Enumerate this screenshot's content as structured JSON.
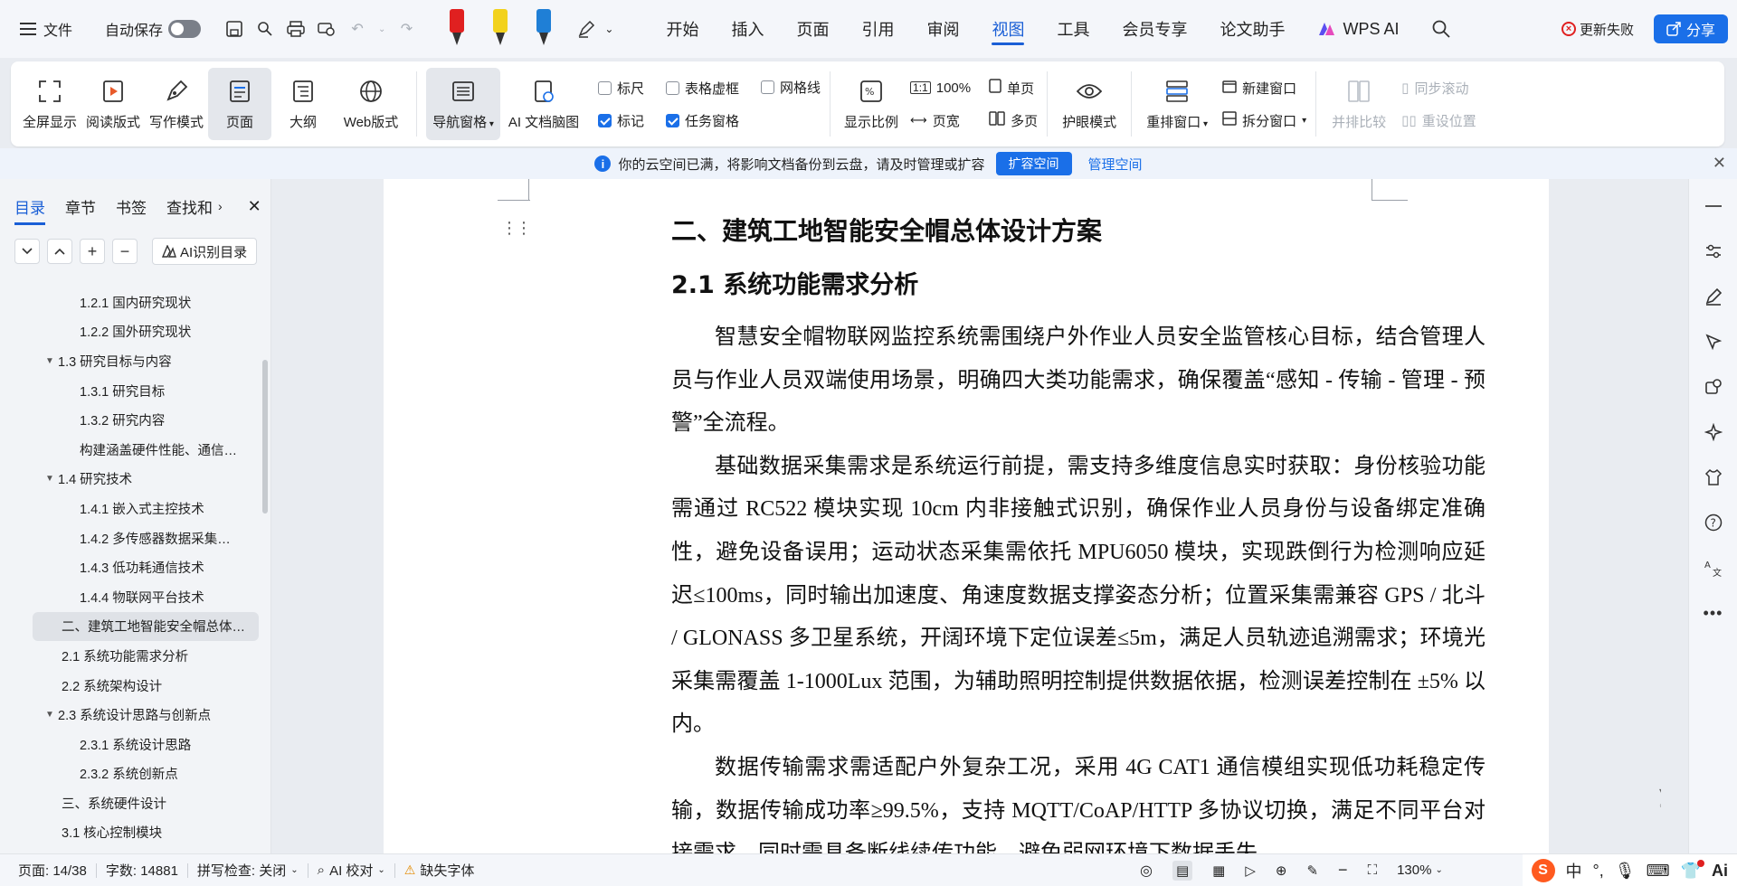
{
  "menubar": {
    "file_label": "文件",
    "autosave_label": "自动保存",
    "tabs": [
      "开始",
      "插入",
      "页面",
      "引用",
      "审阅",
      "视图",
      "工具",
      "会员专享",
      "论文助手",
      "WPS AI"
    ],
    "active_tab": "视图",
    "update_failed_label": "更新失败",
    "share_label": "分享",
    "pen_colors": [
      "#e02020",
      "#f2d21c",
      "#1f7fd6"
    ]
  },
  "ribbon": {
    "fullscreen": "全屏显示",
    "read_mode": "阅读版式",
    "write_mode": "写作模式",
    "page": "页面",
    "outline": "大纲",
    "web_mode": "Web版式",
    "nav_pane": "导航窗格",
    "ai_mindmap": "AI 文档脑图",
    "ruler": "标尺",
    "table_gridlines": "表格虚框",
    "gridlines": "网格线",
    "marks": "标记",
    "task_pane": "任务窗格",
    "display_ratio": "显示比例",
    "zoom_100": "100%",
    "single_page": "单页",
    "page_width": "页宽",
    "multi_page": "多页",
    "eye_mode": "护眼模式",
    "rearrange_windows": "重排窗口",
    "new_window": "新建窗口",
    "split_window": "拆分窗口",
    "side_by_side": "并排比较",
    "sync_scroll": "同步滚动",
    "reset_position": "重设位置"
  },
  "notice": {
    "message": "你的云空间已满，将影响文档备份到云盘，请及时管理或扩容",
    "expand_label": "扩容空间",
    "manage_label": "管理空间"
  },
  "sidebar": {
    "tabs": [
      "目录",
      "章节",
      "书签",
      "查找和"
    ],
    "ai_toc_label": "AI识别目录",
    "toc": [
      {
        "label": "1.2.1  国内研究现状",
        "level": 3,
        "arrow": false
      },
      {
        "label": "1.2.2  国外研究现状",
        "level": 3,
        "arrow": false
      },
      {
        "label": "1.3  研究目标与内容",
        "level": 2,
        "arrow": true
      },
      {
        "label": "1.3.1  研究目标",
        "level": 3,
        "arrow": false
      },
      {
        "label": "1.3.2  研究内容",
        "level": 3,
        "arrow": false
      },
      {
        "label": "构建涵盖硬件性能、通信…",
        "level": 3,
        "arrow": false
      },
      {
        "label": "1.4  研究技术",
        "level": 2,
        "arrow": true
      },
      {
        "label": "1.4.1  嵌入式主控技术",
        "level": 3,
        "arrow": false
      },
      {
        "label": "1.4.2  多传感器数据采集…",
        "level": 3,
        "arrow": false
      },
      {
        "label": "1.4.3  低功耗通信技术",
        "level": 3,
        "arrow": false
      },
      {
        "label": "1.4.4  物联网平台技术",
        "level": 3,
        "arrow": false
      },
      {
        "label": "二、建筑工地智能安全帽总体…",
        "level": 1,
        "arrow": false,
        "selected": true
      },
      {
        "label": "2.1  系统功能需求分析",
        "level": 2,
        "arrow": false
      },
      {
        "label": "2.2  系统架构设计",
        "level": 2,
        "arrow": false
      },
      {
        "label": "2.3  系统设计思路与创新点",
        "level": 2,
        "arrow": true
      },
      {
        "label": "2.3.1  系统设计思路",
        "level": 3,
        "arrow": false
      },
      {
        "label": "2.3.2  系统创新点",
        "level": 3,
        "arrow": false
      },
      {
        "label": "三、系统硬件设计",
        "level": 2,
        "arrow": false
      },
      {
        "label": "3.1  核心控制模块",
        "level": 2,
        "arrow": false
      }
    ]
  },
  "document": {
    "heading1": "二、建筑工地智能安全帽总体设计方案",
    "heading2": "2.1  系统功能需求分析",
    "paragraphs": [
      "智慧安全帽物联网监控系统需围绕户外作业人员安全监管核心目标，结合管理人员与作业人员双端使用场景，明确四大类功能需求，确保覆盖“感知 - 传输 - 管理 - 预警”全流程。",
      "基础数据采集需求是系统运行前提，需支持多维度信息实时获取：身份核验功能需通过 RC522 模块实现 10cm 内非接触式识别，确保作业人员身份与设备绑定准确性，避免设备误用；运动状态采集需依托 MPU6050 模块，实现跌倒行为检测响应延迟≤100ms，同时输出加速度、角速度数据支撑姿态分析；位置采集需兼容 GPS / 北斗 / GLONASS 多卫星系统，开阔环境下定位误差≤5m，满足人员轨迹追溯需求；环境光采集需覆盖 1-1000Lux 范围，为辅助照明控制提供数据依据，检测误差控制在 ±5% 以内。",
      "数据传输需求需适配户外复杂工况，采用 4G CAT1 通信模组实现低功耗稳定传输，数据传输成功率≥99.5%，支持 MQTT/CoAP/HTTP 多协议切换，满足不同平台对接需求，同时需具备断线续传功能，避免弱网环境下数据丢失。"
    ]
  },
  "statusbar": {
    "page": "页面: 14/38",
    "word_count": "字数: 14881",
    "spell_check": "拼写检查: 关闭",
    "ai_proofread": "AI 校对",
    "missing_font": "缺失字体",
    "zoom": "130%"
  },
  "ime": {
    "mode": "中",
    "punct": "°,",
    "ai": "Ai"
  }
}
